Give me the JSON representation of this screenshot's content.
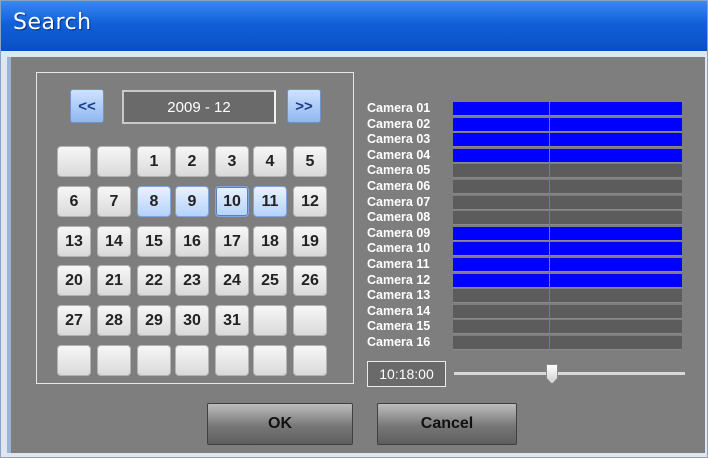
{
  "window": {
    "title": "Search"
  },
  "calendar": {
    "prev_label": "<<",
    "next_label": ">>",
    "month_label": "2009 - 12",
    "weeks": [
      [
        "",
        "",
        "1",
        "2",
        "3",
        "4",
        "5"
      ],
      [
        "6",
        "7",
        "8",
        "9",
        "10",
        "11",
        "12"
      ],
      [
        "13",
        "14",
        "15",
        "16",
        "17",
        "18",
        "19"
      ],
      [
        "20",
        "21",
        "22",
        "23",
        "24",
        "25",
        "26"
      ],
      [
        "27",
        "28",
        "29",
        "30",
        "31",
        "",
        ""
      ],
      [
        "",
        "",
        "",
        "",
        "",
        "",
        ""
      ]
    ],
    "recorded_days": [
      "8",
      "9",
      "10",
      "11"
    ],
    "selected_day": "10"
  },
  "cameras": [
    {
      "label": "Camera 01",
      "recorded": true
    },
    {
      "label": "Camera 02",
      "recorded": true
    },
    {
      "label": "Camera 03",
      "recorded": true
    },
    {
      "label": "Camera 04",
      "recorded": true
    },
    {
      "label": "Camera 05",
      "recorded": false
    },
    {
      "label": "Camera 06",
      "recorded": false
    },
    {
      "label": "Camera 07",
      "recorded": false
    },
    {
      "label": "Camera 08",
      "recorded": false
    },
    {
      "label": "Camera 09",
      "recorded": true
    },
    {
      "label": "Camera 10",
      "recorded": true
    },
    {
      "label": "Camera 11",
      "recorded": true
    },
    {
      "label": "Camera 12",
      "recorded": true
    },
    {
      "label": "Camera 13",
      "recorded": false
    },
    {
      "label": "Camera 14",
      "recorded": false
    },
    {
      "label": "Camera 15",
      "recorded": false
    },
    {
      "label": "Camera 16",
      "recorded": false
    }
  ],
  "timeline": {
    "time": "10:18:00",
    "record_color": "#0000ff",
    "cursor_color": "#00d000"
  },
  "buttons": {
    "ok": "OK",
    "cancel": "Cancel"
  }
}
